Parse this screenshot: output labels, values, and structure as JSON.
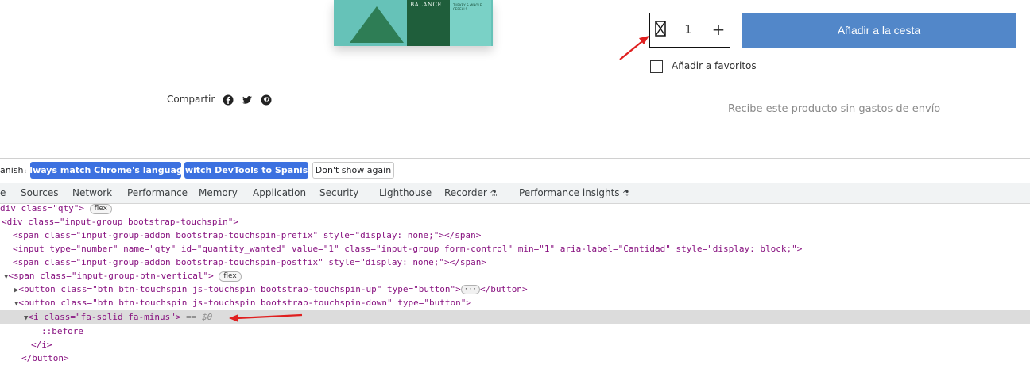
{
  "product": {
    "box_brand": "BALANCE",
    "box_subtitle": "TURKEY & WHOLE CEREALS",
    "quantity_value": "1",
    "quantity_minus_icon": "x-box-icon",
    "quantity_plus_label": "+",
    "add_to_cart_label": "Añadir a la cesta",
    "favorites_label": "Añadir a favoritos",
    "share_label": "Compartir",
    "share_icons": [
      "facebook-icon",
      "twitter-icon",
      "pinterest-icon"
    ],
    "free_shipping_text": "Recibe este producto sin gastos de envío",
    "button_color": "#5287c9"
  },
  "devtools": {
    "infobar_text": "anish!",
    "buttons": {
      "match_language": "Always match Chrome's language",
      "switch_spanish": "Switch DevTools to Spanish",
      "dont_show": "Don't show again"
    },
    "tabs": [
      "e",
      "Sources",
      "Network",
      "Performance",
      "Memory",
      "Application",
      "Security",
      "Lighthouse",
      "Recorder",
      "Performance insights"
    ],
    "flex_badge": "flex",
    "selected_marker": "== $0",
    "lines": {
      "l1": "div class=\"qty\">",
      "l2": "<div class=\"input-group bootstrap-touchspin\">",
      "l3": "<span class=\"input-group-addon bootstrap-touchspin-prefix\" style=\"display: none;\"></span>",
      "l4": "<input type=\"number\" name=\"qty\" id=\"quantity_wanted\" value=\"1\" class=\"input-group form-control\" min=\"1\" aria-label=\"Cantidad\" style=\"display: block;\">",
      "l5": "<span class=\"input-group-addon bootstrap-touchspin-postfix\" style=\"display: none;\"></span>",
      "l6": "<span class=\"input-group-btn-vertical\">",
      "l7a": "<button class=\"btn btn-touchspin js-touchspin bootstrap-touchspin-up\" type=\"button\">",
      "l7b": "</button>",
      "l8": "<button class=\"btn btn-touchspin js-touchspin bootstrap-touchspin-down\" type=\"button\">",
      "l9": "<i class=\"fa-solid fa-minus\">",
      "l10": "::before",
      "l11": "</i>",
      "l12": "</button>"
    }
  }
}
